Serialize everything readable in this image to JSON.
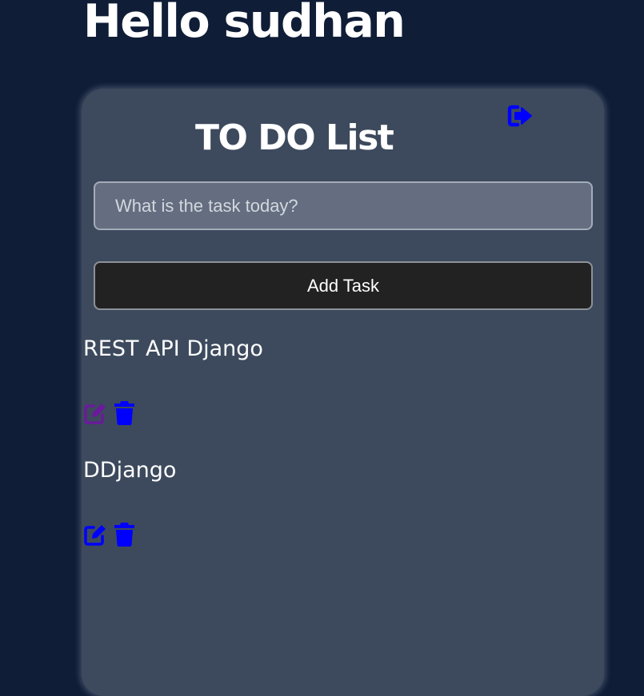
{
  "greeting": "Hello sudhan",
  "card": {
    "title": "TO DO List",
    "input_placeholder": "What is the task today?",
    "add_button_label": "Add Task"
  },
  "tasks": [
    {
      "text": "REST API Django"
    },
    {
      "text": "DDjango"
    }
  ],
  "icons": {
    "logout": "sign-out-icon",
    "edit": "edit-icon",
    "delete": "trash-icon"
  },
  "colors": {
    "background": "#0f1d37",
    "card": "#3d4a5d",
    "icon_blue": "#0000ff",
    "icon_visited_purple": "#6a1b9a",
    "button_bg": "#222222"
  }
}
